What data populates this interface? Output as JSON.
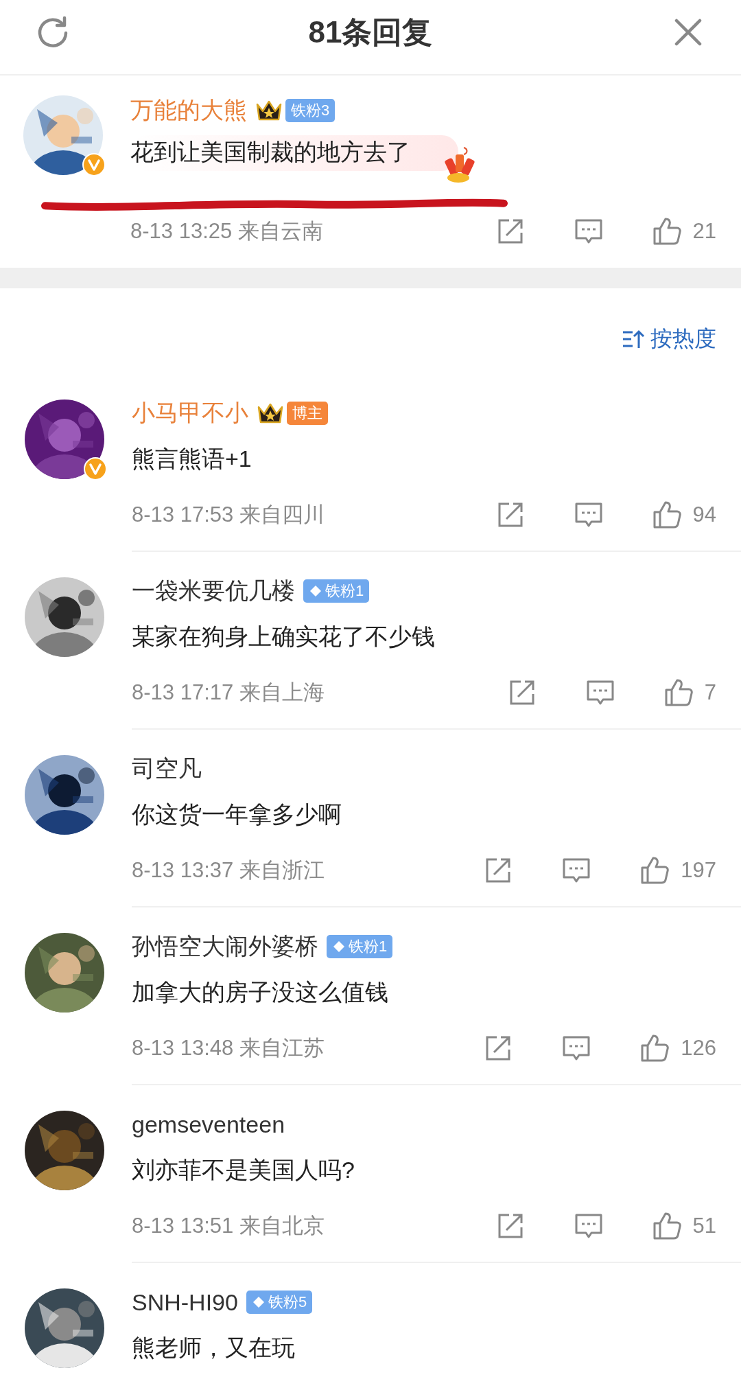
{
  "header": {
    "title": "81条回复"
  },
  "main_comment": {
    "name": "万能的大熊",
    "highlight_name": true,
    "verified": true,
    "crown": true,
    "badge": {
      "kind": "fan",
      "diamond": false,
      "text": "铁粉3"
    },
    "text": "花到让美国制裁的地方去了",
    "sticker": true,
    "scribbled": true,
    "meta": "8-13 13:25 来自云南",
    "likes": "21"
  },
  "sort": {
    "label": "按热度"
  },
  "replies": [
    {
      "name": "小马甲不小",
      "highlight_name": true,
      "verified": true,
      "crown": true,
      "badge": {
        "kind": "blogger",
        "diamond": false,
        "text": "博主"
      },
      "text": "熊言熊语+1",
      "meta": "8-13 17:53 来自四川",
      "likes": "94"
    },
    {
      "name": "一袋米要伉几楼",
      "highlight_name": false,
      "verified": false,
      "crown": false,
      "badge": {
        "kind": "fan",
        "diamond": true,
        "text": "铁粉1"
      },
      "text": "某家在狗身上确实花了不少钱",
      "meta": "8-13 17:17 来自上海",
      "likes": "7"
    },
    {
      "name": "司空凡",
      "highlight_name": false,
      "verified": false,
      "crown": false,
      "text": "你这货一年拿多少啊",
      "meta": "8-13 13:37 来自浙江",
      "likes": "197"
    },
    {
      "name": "孙悟空大闹外婆桥",
      "highlight_name": false,
      "verified": false,
      "crown": false,
      "badge": {
        "kind": "fan",
        "diamond": true,
        "text": "铁粉1"
      },
      "text": "加拿大的房子没这么值钱",
      "meta": "8-13 13:48 来自江苏",
      "likes": "126"
    },
    {
      "name": "gemseventeen",
      "highlight_name": false,
      "verified": false,
      "crown": false,
      "text": "刘亦菲不是美国人吗?",
      "meta": "8-13 13:51 来自北京",
      "likes": "51"
    },
    {
      "name": "SNH-HI90",
      "highlight_name": false,
      "verified": false,
      "crown": false,
      "badge": {
        "kind": "fan",
        "diamond": true,
        "text": "铁粉5"
      },
      "text": "熊老师，又在玩"
    }
  ]
}
